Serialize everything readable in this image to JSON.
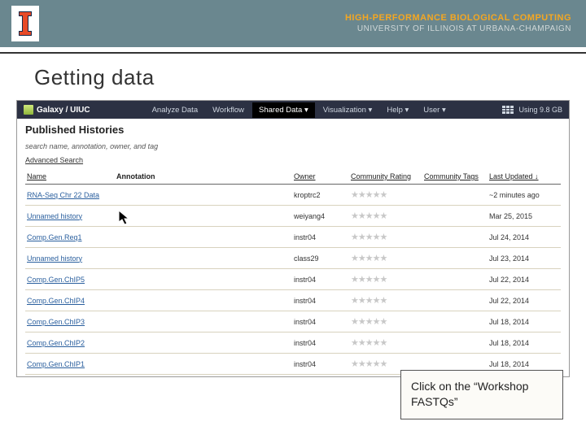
{
  "banner": {
    "line1": "HIGH-PERFORMANCE BIOLOGICAL COMPUTING",
    "line2": "UNIVERSITY OF ILLINOIS AT URBANA-CHAMPAIGN"
  },
  "slide": {
    "title": "Getting data"
  },
  "nav": {
    "brand": "Galaxy / UIUC",
    "items": [
      "Analyze Data",
      "Workflow",
      "Shared Data ▾",
      "Visualization ▾",
      "Help ▾",
      "User ▾"
    ],
    "active_index": 2,
    "usage": "Using 9.8 GB"
  },
  "published": {
    "heading": "Published Histories",
    "search_placeholder": "search name, annotation, owner, and tag",
    "advanced": "Advanced Search",
    "columns": [
      "Name",
      "Annotation",
      "Owner",
      "Community Rating",
      "Community Tags",
      "Last Updated ↓"
    ],
    "rows": [
      {
        "name": "RNA-Seq Chr 22 Data",
        "owner": "kroptrc2",
        "date": "~2 minutes ago"
      },
      {
        "name": "Unnamed history",
        "owner": "weiyang4",
        "date": "Mar 25, 2015"
      },
      {
        "name": "Comp.Gen.Req1",
        "owner": "instr04",
        "date": "Jul 24, 2014"
      },
      {
        "name": "Unnamed history",
        "owner": "class29",
        "date": "Jul 23, 2014"
      },
      {
        "name": "Comp.Gen.ChIP5",
        "owner": "instr04",
        "date": "Jul 22, 2014"
      },
      {
        "name": "Comp.Gen.ChIP4",
        "owner": "instr04",
        "date": "Jul 22, 2014"
      },
      {
        "name": "Comp.Gen.ChIP3",
        "owner": "instr04",
        "date": "Jul 18, 2014"
      },
      {
        "name": "Comp.Gen.ChIP2",
        "owner": "instr04",
        "date": "Jul 18, 2014"
      },
      {
        "name": "Comp.Gen.ChIP1",
        "owner": "instr04",
        "date": "Jul 18, 2014"
      }
    ]
  },
  "callout": {
    "text": "Click on the “Workshop FASTQs”"
  }
}
